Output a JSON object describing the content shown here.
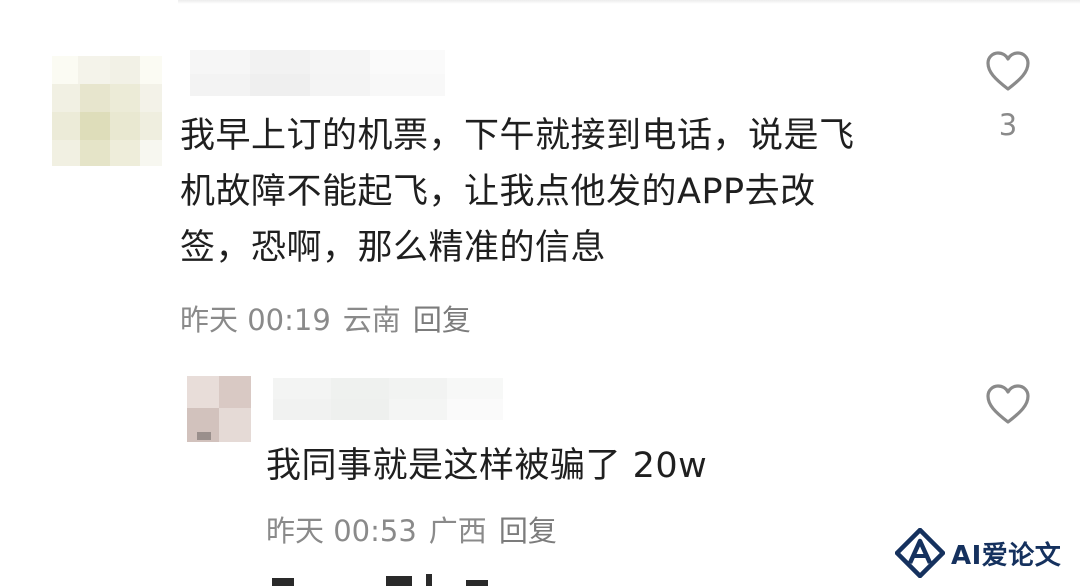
{
  "comment1": {
    "lines": [
      "我早上订的机票，下午就接到电话，说是飞",
      "机故障不能起飞，让我点他发的APP去改",
      "签，恐啊，那么精准的信息"
    ],
    "time": "昨天 00:19",
    "location": "云南",
    "reply_label": "回复",
    "like_count": "3",
    "icon_name": "heart-icon"
  },
  "comment2": {
    "text": "我同事就是这样被骗了 20w",
    "time": "昨天 00:53",
    "location": "广西",
    "reply_label": "回复",
    "icon_name": "heart-icon"
  },
  "watermark": {
    "text": "AI爱论文",
    "color": "#15315e"
  }
}
